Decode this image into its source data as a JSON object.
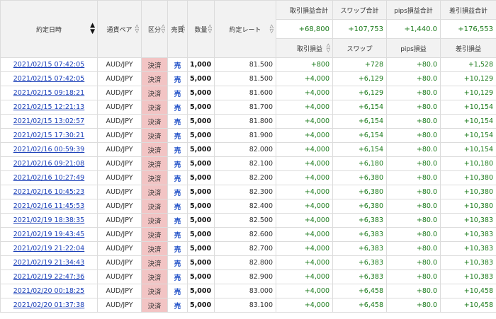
{
  "header": {
    "date": "約定日時",
    "pair": "通貨ペア",
    "kind": "区分",
    "side": "売買",
    "qty": "数量",
    "rate": "約定レート",
    "sum_pl_title": "取引損益合計",
    "sum_swap_title": "スワップ合計",
    "sum_pips_title": "pips損益合計",
    "sum_net_title": "差引損益合計",
    "sum_pl": "+68,800",
    "sum_swap": "+107,753",
    "sum_pips": "+1,440.0",
    "sum_net": "+176,553",
    "pl": "取引損益",
    "swap": "スワップ",
    "pips": "pips損益",
    "net": "差引損益",
    "arrow_up": "▲",
    "arrow_down": "▽",
    "arrow_tri_up": "△",
    "arrow_tri_down": "▼"
  },
  "rows": [
    {
      "date": "2021/02/15 07:42:05",
      "pair": "AUD/JPY",
      "kind": "決済",
      "side": "売",
      "qty": "1,000",
      "rate": "81.500",
      "pl": "+800",
      "swap": "+728",
      "pips": "+80.0",
      "net": "+1,528"
    },
    {
      "date": "2021/02/15 07:42:05",
      "pair": "AUD/JPY",
      "kind": "決済",
      "side": "売",
      "qty": "5,000",
      "rate": "81.500",
      "pl": "+4,000",
      "swap": "+6,129",
      "pips": "+80.0",
      "net": "+10,129"
    },
    {
      "date": "2021/02/15 09:18:21",
      "pair": "AUD/JPY",
      "kind": "決済",
      "side": "売",
      "qty": "5,000",
      "rate": "81.600",
      "pl": "+4,000",
      "swap": "+6,129",
      "pips": "+80.0",
      "net": "+10,129"
    },
    {
      "date": "2021/02/15 12:21:13",
      "pair": "AUD/JPY",
      "kind": "決済",
      "side": "売",
      "qty": "5,000",
      "rate": "81.700",
      "pl": "+4,000",
      "swap": "+6,154",
      "pips": "+80.0",
      "net": "+10,154"
    },
    {
      "date": "2021/02/15 13:02:57",
      "pair": "AUD/JPY",
      "kind": "決済",
      "side": "売",
      "qty": "5,000",
      "rate": "81.800",
      "pl": "+4,000",
      "swap": "+6,154",
      "pips": "+80.0",
      "net": "+10,154"
    },
    {
      "date": "2021/02/15 17:30:21",
      "pair": "AUD/JPY",
      "kind": "決済",
      "side": "売",
      "qty": "5,000",
      "rate": "81.900",
      "pl": "+4,000",
      "swap": "+6,154",
      "pips": "+80.0",
      "net": "+10,154"
    },
    {
      "date": "2021/02/16 00:59:39",
      "pair": "AUD/JPY",
      "kind": "決済",
      "side": "売",
      "qty": "5,000",
      "rate": "82.000",
      "pl": "+4,000",
      "swap": "+6,154",
      "pips": "+80.0",
      "net": "+10,154"
    },
    {
      "date": "2021/02/16 09:21:08",
      "pair": "AUD/JPY",
      "kind": "決済",
      "side": "売",
      "qty": "5,000",
      "rate": "82.100",
      "pl": "+4,000",
      "swap": "+6,180",
      "pips": "+80.0",
      "net": "+10,180"
    },
    {
      "date": "2021/02/16 10:27:49",
      "pair": "AUD/JPY",
      "kind": "決済",
      "side": "売",
      "qty": "5,000",
      "rate": "82.200",
      "pl": "+4,000",
      "swap": "+6,380",
      "pips": "+80.0",
      "net": "+10,380"
    },
    {
      "date": "2021/02/16 10:45:23",
      "pair": "AUD/JPY",
      "kind": "決済",
      "side": "売",
      "qty": "5,000",
      "rate": "82.300",
      "pl": "+4,000",
      "swap": "+6,380",
      "pips": "+80.0",
      "net": "+10,380"
    },
    {
      "date": "2021/02/16 11:45:53",
      "pair": "AUD/JPY",
      "kind": "決済",
      "side": "売",
      "qty": "5,000",
      "rate": "82.400",
      "pl": "+4,000",
      "swap": "+6,380",
      "pips": "+80.0",
      "net": "+10,380"
    },
    {
      "date": "2021/02/19 18:38:35",
      "pair": "AUD/JPY",
      "kind": "決済",
      "side": "売",
      "qty": "5,000",
      "rate": "82.500",
      "pl": "+4,000",
      "swap": "+6,383",
      "pips": "+80.0",
      "net": "+10,383"
    },
    {
      "date": "2021/02/19 19:43:45",
      "pair": "AUD/JPY",
      "kind": "決済",
      "side": "売",
      "qty": "5,000",
      "rate": "82.600",
      "pl": "+4,000",
      "swap": "+6,383",
      "pips": "+80.0",
      "net": "+10,383"
    },
    {
      "date": "2021/02/19 21:22:04",
      "pair": "AUD/JPY",
      "kind": "決済",
      "side": "売",
      "qty": "5,000",
      "rate": "82.700",
      "pl": "+4,000",
      "swap": "+6,383",
      "pips": "+80.0",
      "net": "+10,383"
    },
    {
      "date": "2021/02/19 21:34:43",
      "pair": "AUD/JPY",
      "kind": "決済",
      "side": "売",
      "qty": "5,000",
      "rate": "82.800",
      "pl": "+4,000",
      "swap": "+6,383",
      "pips": "+80.0",
      "net": "+10,383"
    },
    {
      "date": "2021/02/19 22:47:36",
      "pair": "AUD/JPY",
      "kind": "決済",
      "side": "売",
      "qty": "5,000",
      "rate": "82.900",
      "pl": "+4,000",
      "swap": "+6,383",
      "pips": "+80.0",
      "net": "+10,383"
    },
    {
      "date": "2021/02/20 00:18:25",
      "pair": "AUD/JPY",
      "kind": "決済",
      "side": "売",
      "qty": "5,000",
      "rate": "83.000",
      "pl": "+4,000",
      "swap": "+6,458",
      "pips": "+80.0",
      "net": "+10,458"
    },
    {
      "date": "2021/02/20 01:37:38",
      "pair": "AUD/JPY",
      "kind": "決済",
      "side": "売",
      "qty": "5,000",
      "rate": "83.100",
      "pl": "+4,000",
      "swap": "+6,458",
      "pips": "+80.0",
      "net": "+10,458"
    }
  ],
  "colors": {
    "link": "#1a3fb8",
    "positive": "#1a7a1a",
    "side_sell": "#1f4fc7",
    "kind_bg": "#f2c4c4",
    "header_bg": "#f2f2f2"
  }
}
